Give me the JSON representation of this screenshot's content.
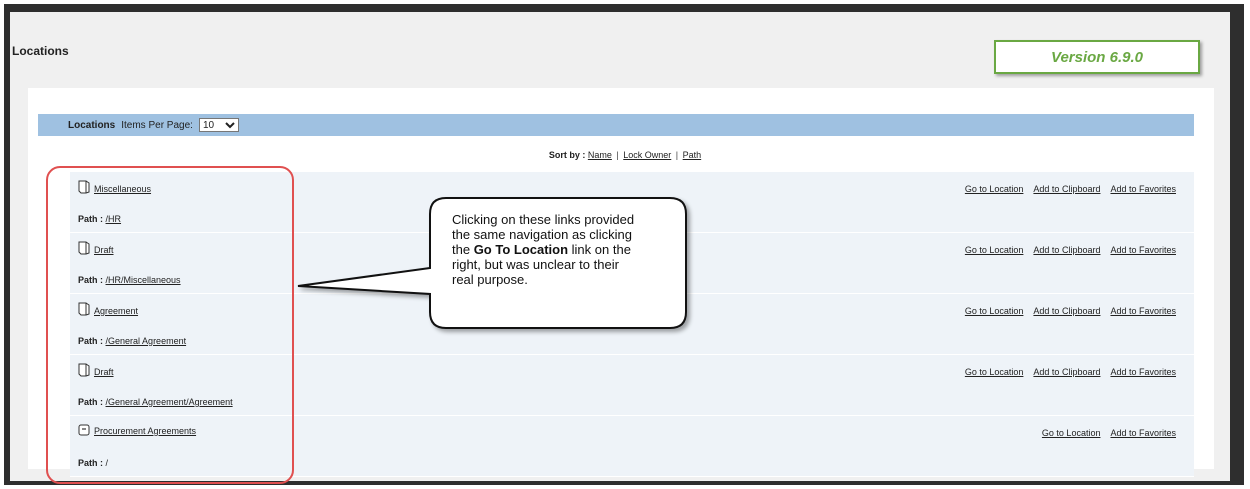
{
  "page": {
    "title": "Locations",
    "version": "Version 6.9.0"
  },
  "toolbar": {
    "title": "Locations",
    "items_label": "Items Per Page:",
    "items_value": "10"
  },
  "sort": {
    "label": "Sort by :",
    "name": "Name",
    "lock_owner": "Lock Owner",
    "path": "Path"
  },
  "path_label": "Path :",
  "actions": {
    "go": "Go to Location",
    "clipboard": "Add to Clipboard",
    "favorites": "Add to Favorites"
  },
  "rows": [
    {
      "name": "Miscellaneous",
      "path": "/HR",
      "icon": "folder-icon"
    },
    {
      "name": "Draft",
      "path": "/HR/Miscellaneous",
      "icon": "folder-icon"
    },
    {
      "name": "Agreement",
      "path": "/General Agreement",
      "icon": "folder-icon"
    },
    {
      "name": "Draft",
      "path": "/General Agreement/Agreement",
      "icon": "folder-icon"
    },
    {
      "name": "Procurement Agreements",
      "path": "/",
      "icon": "cabinet-icon"
    }
  ],
  "callout": {
    "line1": "Clicking on these links provided",
    "line2": "the same navigation as clicking",
    "line3_pre": "the ",
    "line3_bold": "Go To Location",
    "line3_post": " link on the",
    "line4": "right, but was unclear to their",
    "line5": "real purpose."
  }
}
